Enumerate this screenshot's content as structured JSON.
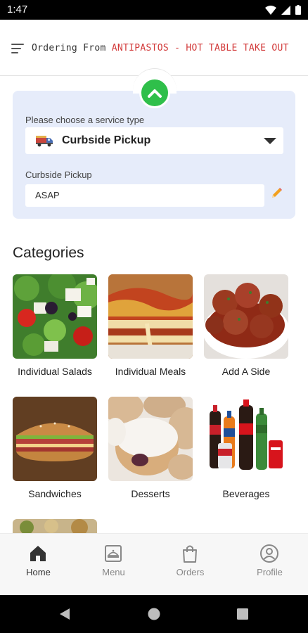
{
  "status_bar": {
    "time": "1:47"
  },
  "header": {
    "prefix": "Ordering From ",
    "store_name": "ANTIPASTOS - HOT TABLE TAKE OUT",
    "accent_color": "#d23a3a"
  },
  "service": {
    "type_label": "Please choose a service type",
    "selected_type": "Curbside Pickup",
    "time_label": "Curbside Pickup",
    "time_value": "ASAP",
    "panel_color": "#e6ecfa",
    "toggle_color": "#2fbf4a"
  },
  "categories": {
    "title": "Categories",
    "items": [
      {
        "label": "Individual Salads"
      },
      {
        "label": "Individual Meals"
      },
      {
        "label": "Add A Side"
      },
      {
        "label": "Sandwiches"
      },
      {
        "label": "Desserts"
      },
      {
        "label": "Beverages"
      }
    ]
  },
  "bottom_nav": {
    "items": [
      {
        "label": "Home",
        "icon": "home-icon",
        "active": true
      },
      {
        "label": "Menu",
        "icon": "menu-book-icon",
        "active": false
      },
      {
        "label": "Orders",
        "icon": "shopping-bag-icon",
        "active": false
      },
      {
        "label": "Profile",
        "icon": "profile-icon",
        "active": false
      }
    ]
  }
}
